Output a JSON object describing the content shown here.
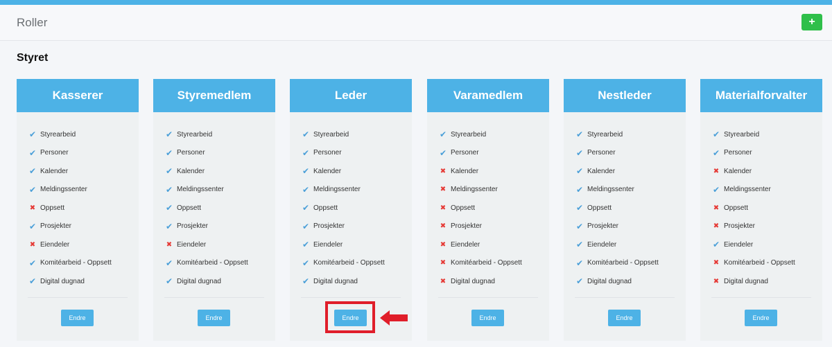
{
  "header": {
    "title": "Roller",
    "add_label": "+"
  },
  "section": {
    "title": "Styret"
  },
  "colors": {
    "accent": "#4db2e6",
    "check": "#4a9fd8",
    "cross": "#e53935",
    "add": "#2fbf4a",
    "highlight": "#e01e2a"
  },
  "permission_labels": [
    "Styrearbeid",
    "Personer",
    "Kalender",
    "Meldingssenter",
    "Oppsett",
    "Prosjekter",
    "Eiendeler",
    "Komitéarbeid - Oppsett",
    "Digital dugnad"
  ],
  "roles": [
    {
      "name": "Kasserer",
      "button": "Endre",
      "perms": [
        true,
        true,
        true,
        true,
        false,
        true,
        false,
        true,
        true
      ]
    },
    {
      "name": "Styremedlem",
      "button": "Endre",
      "perms": [
        true,
        true,
        true,
        true,
        true,
        true,
        false,
        true,
        true
      ]
    },
    {
      "name": "Leder",
      "button": "Endre",
      "perms": [
        true,
        true,
        true,
        true,
        true,
        true,
        true,
        true,
        true
      ]
    },
    {
      "name": "Varamedlem",
      "button": "Endre",
      "perms": [
        true,
        true,
        false,
        false,
        false,
        false,
        false,
        false,
        false
      ]
    },
    {
      "name": "Nestleder",
      "button": "Endre",
      "perms": [
        true,
        true,
        true,
        true,
        true,
        true,
        true,
        true,
        true
      ]
    },
    {
      "name": "Materialforvalter",
      "button": "Endre",
      "perms": [
        true,
        true,
        false,
        true,
        false,
        false,
        true,
        false,
        false
      ]
    }
  ]
}
